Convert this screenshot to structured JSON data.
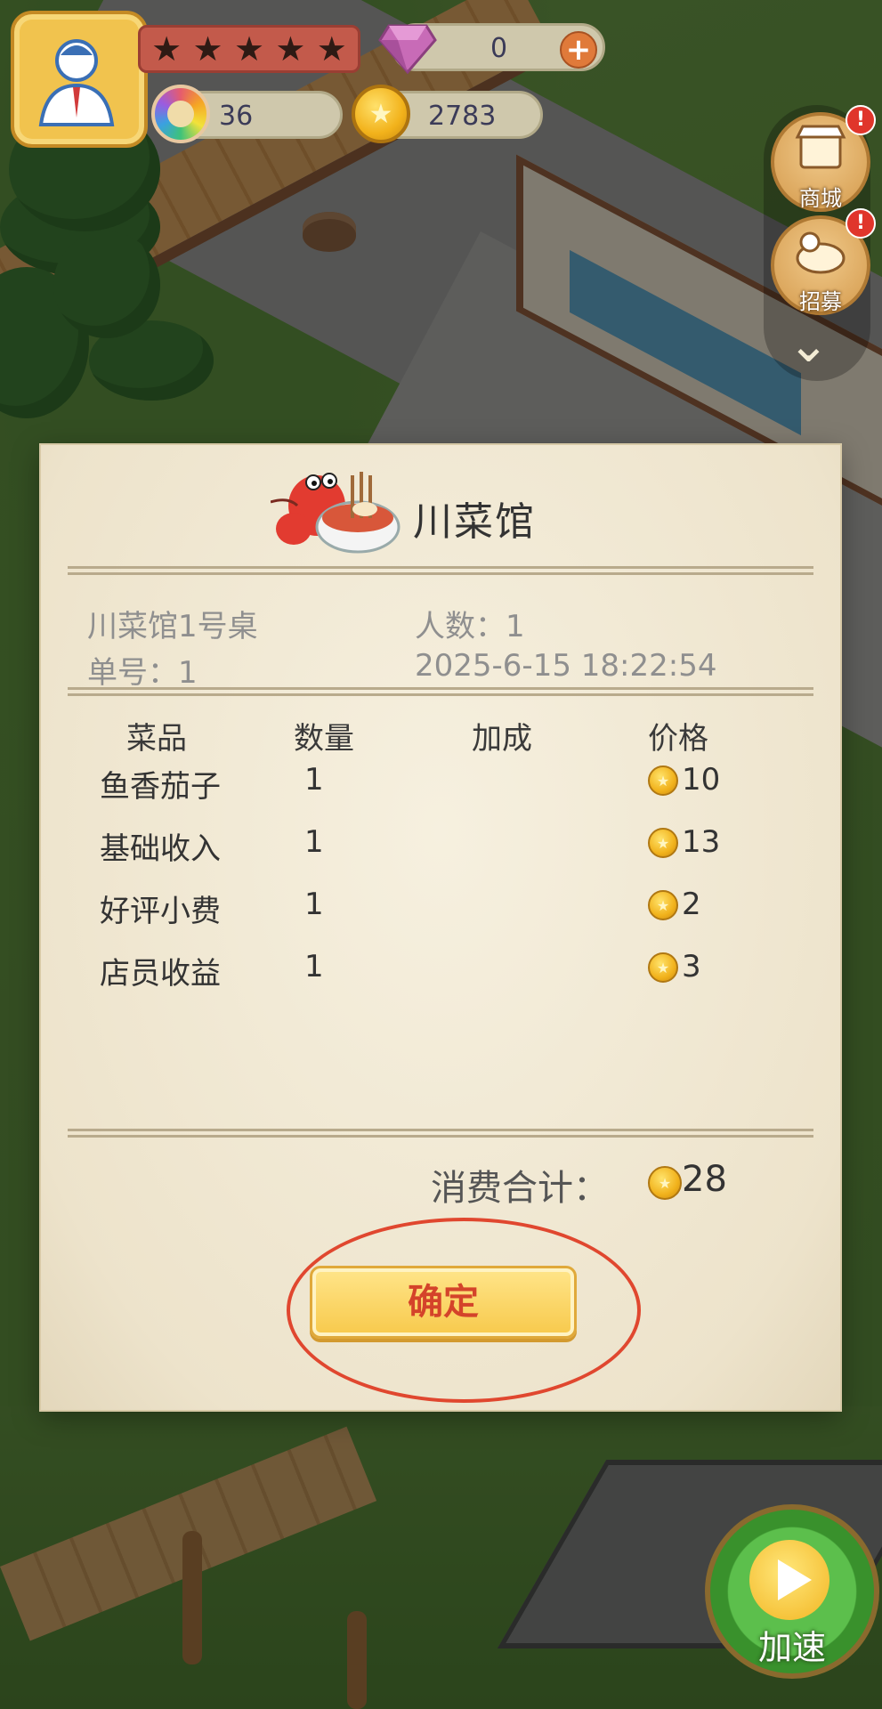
{
  "hud": {
    "stars_filled": 0,
    "stars_total": 5,
    "gems": "0",
    "tokens": "36",
    "coins": "2783",
    "shop_label": "商城",
    "recruit_label": "招募",
    "badge_mark": "!",
    "speed_label": "加速"
  },
  "receipt": {
    "restaurant_name": "川菜馆",
    "table": "川菜馆1号桌",
    "guests": "人数：1",
    "order_no": "单号：1",
    "datetime": "2025-6-15 18:22:54",
    "headers": {
      "item": "菜品",
      "qty": "数量",
      "bonus": "加成",
      "price": "价格"
    },
    "rows": [
      {
        "item": "鱼香茄子",
        "qty": "1",
        "bonus": "",
        "price": "10"
      },
      {
        "item": "基础收入",
        "qty": "1",
        "bonus": "",
        "price": "13"
      },
      {
        "item": "好评小费",
        "qty": "1",
        "bonus": "",
        "price": "2"
      },
      {
        "item": "店员收益",
        "qty": "1",
        "bonus": "",
        "price": "3"
      }
    ],
    "total_label": "消费合计：",
    "total_value": "28",
    "confirm_label": "确定"
  },
  "colors": {
    "confirm_text": "#d4432a",
    "highlight_circle": "#e0472f",
    "paper": "#f3ecd8"
  }
}
